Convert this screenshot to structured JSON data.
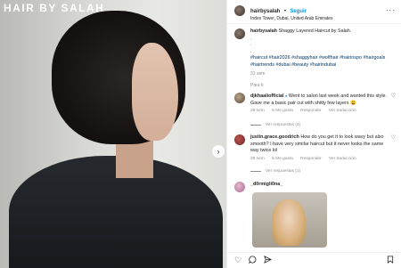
{
  "photo": {
    "brand": "HAIR BY SALAH"
  },
  "post": {
    "username": "hairbysalah",
    "separator": "•",
    "follow_label": "Seguir",
    "location": "Index Tower, Dubai, United Arab Emirates",
    "more_label": "···",
    "caption_text": "Shaggy Layered Haircut by Salah.",
    "caption_dots": [
      ".",
      ".",
      "."
    ],
    "hashtags": "#haircut #hair2026 #shaggyhair #wolfhair #hairinspo #hairgoals #hairtrends #dubai #beauty #hairindubai",
    "time": "31 sem",
    "translate_label": "Para ti"
  },
  "comments": [
    {
      "user": "djkhaaliofficial",
      "verified": "●",
      "text": "Went to salon last week and wanted this style. Gave me a basic pair cut with shitty few layers 😩",
      "time": "29 sem",
      "likes": "6 Me gusta",
      "reply_label": "Responder",
      "see_translation": "Ver traducción",
      "view_replies": "Ver respuestas (4)"
    },
    {
      "user": "justin.grace.goodrich",
      "text": "How do you get it to look wavy but also smooth? I have very similar haircut but it never looks the same way twice lol",
      "time": "29 sem",
      "likes": "6 Me gusta",
      "reply_label": "Responder",
      "see_translation": "Ver traducción",
      "view_replies": "Ver respuestas (1)"
    },
    {
      "user": "_d0rmigli0na_"
    }
  ],
  "icons": {
    "next": "chevron-right-icon",
    "heart": "heart-icon",
    "comment": "comment-icon",
    "share": "share-icon",
    "bookmark": "bookmark-icon"
  }
}
